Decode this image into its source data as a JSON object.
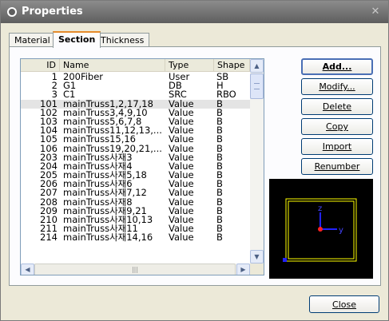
{
  "window": {
    "title": "Properties"
  },
  "tabs": [
    {
      "label": "Material"
    },
    {
      "label": "Section",
      "active": true
    },
    {
      "label": "Thickness"
    }
  ],
  "list": {
    "columns": [
      "ID",
      "Name",
      "Type",
      "Shape"
    ],
    "selected_index": 3,
    "rows": [
      {
        "id": "1",
        "name": "200Fiber",
        "type": "User",
        "shape": "SB"
      },
      {
        "id": "2",
        "name": "G1",
        "type": "DB",
        "shape": "H"
      },
      {
        "id": "3",
        "name": "C1",
        "type": "SRC",
        "shape": "RBO"
      },
      {
        "id": "101",
        "name": "mainTruss1,2,17,18",
        "type": "Value",
        "shape": "B"
      },
      {
        "id": "102",
        "name": "mainTruss3,4,9,10",
        "type": "Value",
        "shape": "B"
      },
      {
        "id": "103",
        "name": "mainTruss5,6,7,8",
        "type": "Value",
        "shape": "B"
      },
      {
        "id": "104",
        "name": "mainTruss11,12,13,...",
        "type": "Value",
        "shape": "B"
      },
      {
        "id": "105",
        "name": "mainTruss15,16",
        "type": "Value",
        "shape": "B"
      },
      {
        "id": "106",
        "name": "mainTruss19,20,21,...",
        "type": "Value",
        "shape": "B"
      },
      {
        "id": "203",
        "name": "mainTruss사재3",
        "type": "Value",
        "shape": "B"
      },
      {
        "id": "204",
        "name": "mainTruss사재4",
        "type": "Value",
        "shape": "B"
      },
      {
        "id": "205",
        "name": "mainTruss사재5,18",
        "type": "Value",
        "shape": "B"
      },
      {
        "id": "206",
        "name": "mainTruss사재6",
        "type": "Value",
        "shape": "B"
      },
      {
        "id": "207",
        "name": "mainTruss사재7,12",
        "type": "Value",
        "shape": "B"
      },
      {
        "id": "208",
        "name": "mainTruss사재8",
        "type": "Value",
        "shape": "B"
      },
      {
        "id": "209",
        "name": "mainTruss사재9,21",
        "type": "Value",
        "shape": "B"
      },
      {
        "id": "210",
        "name": "mainTruss사재10,13",
        "type": "Value",
        "shape": "B"
      },
      {
        "id": "211",
        "name": "mainTruss사재11",
        "type": "Value",
        "shape": "B"
      },
      {
        "id": "214",
        "name": "mainTruss사재14,16",
        "type": "Value",
        "shape": "B"
      }
    ]
  },
  "buttons": {
    "add": "Add...",
    "modify": "Modify...",
    "delete": "Delete",
    "copy": "Copy",
    "import": "Import",
    "renumber": "Renumber",
    "close": "Close"
  },
  "preview": {
    "axis_z_label": "z",
    "axis_y_label": "y",
    "colors": {
      "background": "#000000",
      "outline": "#ffff00",
      "axis": "#2222ff",
      "origin": "#ff2020"
    }
  },
  "icons": {
    "title": "collapse-circle-icon",
    "close": "close-icon",
    "scroll_up": "arrow-up-icon",
    "scroll_down": "arrow-down-icon",
    "scroll_left": "arrow-left-icon",
    "scroll_right": "arrow-right-icon"
  }
}
